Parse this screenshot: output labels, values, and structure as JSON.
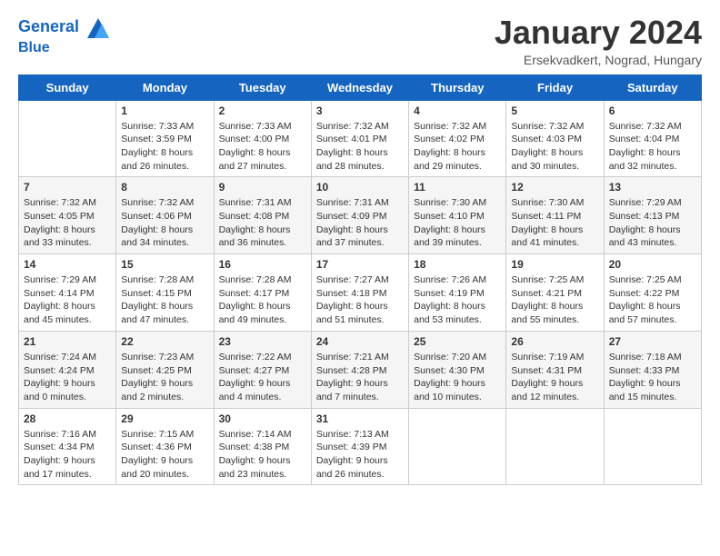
{
  "header": {
    "logo_line1": "General",
    "logo_line2": "Blue",
    "month_title": "January 2024",
    "subtitle": "Ersekvadkert, Nograd, Hungary"
  },
  "days_of_week": [
    "Sunday",
    "Monday",
    "Tuesday",
    "Wednesday",
    "Thursday",
    "Friday",
    "Saturday"
  ],
  "weeks": [
    [
      {
        "day": "",
        "info": ""
      },
      {
        "day": "1",
        "info": "Sunrise: 7:33 AM\nSunset: 3:59 PM\nDaylight: 8 hours\nand 26 minutes."
      },
      {
        "day": "2",
        "info": "Sunrise: 7:33 AM\nSunset: 4:00 PM\nDaylight: 8 hours\nand 27 minutes."
      },
      {
        "day": "3",
        "info": "Sunrise: 7:32 AM\nSunset: 4:01 PM\nDaylight: 8 hours\nand 28 minutes."
      },
      {
        "day": "4",
        "info": "Sunrise: 7:32 AM\nSunset: 4:02 PM\nDaylight: 8 hours\nand 29 minutes."
      },
      {
        "day": "5",
        "info": "Sunrise: 7:32 AM\nSunset: 4:03 PM\nDaylight: 8 hours\nand 30 minutes."
      },
      {
        "day": "6",
        "info": "Sunrise: 7:32 AM\nSunset: 4:04 PM\nDaylight: 8 hours\nand 32 minutes."
      }
    ],
    [
      {
        "day": "7",
        "info": "Sunrise: 7:32 AM\nSunset: 4:05 PM\nDaylight: 8 hours\nand 33 minutes."
      },
      {
        "day": "8",
        "info": "Sunrise: 7:32 AM\nSunset: 4:06 PM\nDaylight: 8 hours\nand 34 minutes."
      },
      {
        "day": "9",
        "info": "Sunrise: 7:31 AM\nSunset: 4:08 PM\nDaylight: 8 hours\nand 36 minutes."
      },
      {
        "day": "10",
        "info": "Sunrise: 7:31 AM\nSunset: 4:09 PM\nDaylight: 8 hours\nand 37 minutes."
      },
      {
        "day": "11",
        "info": "Sunrise: 7:30 AM\nSunset: 4:10 PM\nDaylight: 8 hours\nand 39 minutes."
      },
      {
        "day": "12",
        "info": "Sunrise: 7:30 AM\nSunset: 4:11 PM\nDaylight: 8 hours\nand 41 minutes."
      },
      {
        "day": "13",
        "info": "Sunrise: 7:29 AM\nSunset: 4:13 PM\nDaylight: 8 hours\nand 43 minutes."
      }
    ],
    [
      {
        "day": "14",
        "info": "Sunrise: 7:29 AM\nSunset: 4:14 PM\nDaylight: 8 hours\nand 45 minutes."
      },
      {
        "day": "15",
        "info": "Sunrise: 7:28 AM\nSunset: 4:15 PM\nDaylight: 8 hours\nand 47 minutes."
      },
      {
        "day": "16",
        "info": "Sunrise: 7:28 AM\nSunset: 4:17 PM\nDaylight: 8 hours\nand 49 minutes."
      },
      {
        "day": "17",
        "info": "Sunrise: 7:27 AM\nSunset: 4:18 PM\nDaylight: 8 hours\nand 51 minutes."
      },
      {
        "day": "18",
        "info": "Sunrise: 7:26 AM\nSunset: 4:19 PM\nDaylight: 8 hours\nand 53 minutes."
      },
      {
        "day": "19",
        "info": "Sunrise: 7:25 AM\nSunset: 4:21 PM\nDaylight: 8 hours\nand 55 minutes."
      },
      {
        "day": "20",
        "info": "Sunrise: 7:25 AM\nSunset: 4:22 PM\nDaylight: 8 hours\nand 57 minutes."
      }
    ],
    [
      {
        "day": "21",
        "info": "Sunrise: 7:24 AM\nSunset: 4:24 PM\nDaylight: 9 hours\nand 0 minutes."
      },
      {
        "day": "22",
        "info": "Sunrise: 7:23 AM\nSunset: 4:25 PM\nDaylight: 9 hours\nand 2 minutes."
      },
      {
        "day": "23",
        "info": "Sunrise: 7:22 AM\nSunset: 4:27 PM\nDaylight: 9 hours\nand 4 minutes."
      },
      {
        "day": "24",
        "info": "Sunrise: 7:21 AM\nSunset: 4:28 PM\nDaylight: 9 hours\nand 7 minutes."
      },
      {
        "day": "25",
        "info": "Sunrise: 7:20 AM\nSunset: 4:30 PM\nDaylight: 9 hours\nand 10 minutes."
      },
      {
        "day": "26",
        "info": "Sunrise: 7:19 AM\nSunset: 4:31 PM\nDaylight: 9 hours\nand 12 minutes."
      },
      {
        "day": "27",
        "info": "Sunrise: 7:18 AM\nSunset: 4:33 PM\nDaylight: 9 hours\nand 15 minutes."
      }
    ],
    [
      {
        "day": "28",
        "info": "Sunrise: 7:16 AM\nSunset: 4:34 PM\nDaylight: 9 hours\nand 17 minutes."
      },
      {
        "day": "29",
        "info": "Sunrise: 7:15 AM\nSunset: 4:36 PM\nDaylight: 9 hours\nand 20 minutes."
      },
      {
        "day": "30",
        "info": "Sunrise: 7:14 AM\nSunset: 4:38 PM\nDaylight: 9 hours\nand 23 minutes."
      },
      {
        "day": "31",
        "info": "Sunrise: 7:13 AM\nSunset: 4:39 PM\nDaylight: 9 hours\nand 26 minutes."
      },
      {
        "day": "",
        "info": ""
      },
      {
        "day": "",
        "info": ""
      },
      {
        "day": "",
        "info": ""
      }
    ]
  ]
}
